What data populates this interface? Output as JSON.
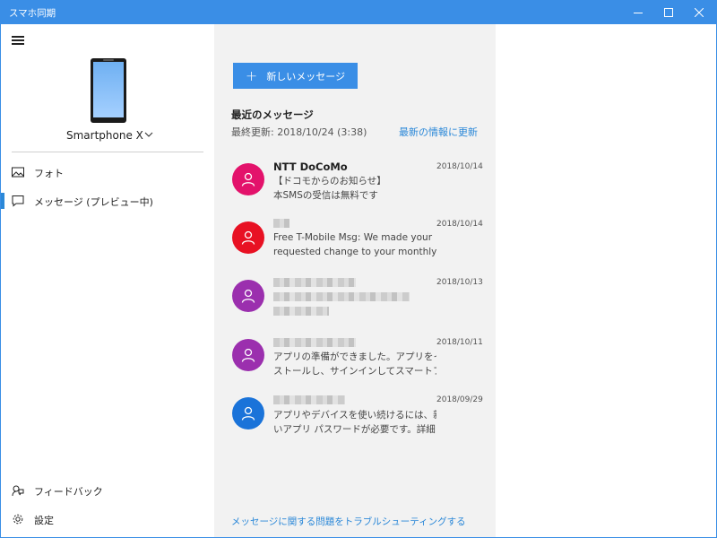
{
  "window": {
    "title": "スマホ同期"
  },
  "nav": {
    "device_name": "Smartphone X",
    "items": [
      {
        "label": "フォト",
        "icon": "photo-icon"
      },
      {
        "label": "メッセージ (プレビュー中)",
        "icon": "message-icon",
        "active": true
      },
      {
        "label": "フィードバック",
        "icon": "feedback-icon"
      },
      {
        "label": "設定",
        "icon": "gear-icon"
      }
    ]
  },
  "messages_pane": {
    "new_message_label": "新しいメッセージ",
    "recent_title": "最近のメッセージ",
    "last_update": "最終更新: 2018/10/24 (3:38)",
    "refresh_label": "最新の情報に更新",
    "troubleshoot_label": "メッセージに関する問題をトラブルシューティングする",
    "messages": [
      {
        "sender": "NTT DoCoMo",
        "date": "2018/10/14",
        "line1": "【ドコモからのお知らせ】",
        "line2": "本SMSの受信は無料です",
        "avatar_color": "#e3126b"
      },
      {
        "sender": "",
        "date": "2018/10/14",
        "line1": "Free T-Mobile Msg: We made your",
        "line2": "requested change to your monthly",
        "avatar_color": "#e81123"
      },
      {
        "sender": "",
        "date": "2018/10/13",
        "line1": "",
        "line2": "",
        "avatar_color": "#9b2fae"
      },
      {
        "sender": "",
        "date": "2018/10/11",
        "line1": "アプリの準備ができました。アプリをイン",
        "line2": "ストールし、サインインしてスマートフォンと",
        "avatar_color": "#9b2fae"
      },
      {
        "sender": "",
        "date": "2018/09/29",
        "line1": "アプリやデバイスを使い続けるには、新し",
        "line2": "いアプリ パスワードが必要です。詳細: ht",
        "avatar_color": "#1a73d9"
      }
    ]
  }
}
